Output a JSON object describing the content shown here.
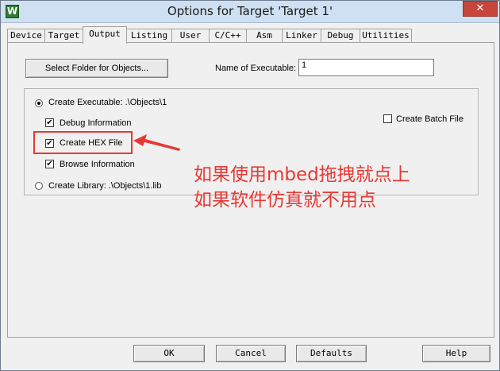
{
  "window": {
    "title": "Options for Target 'Target 1'",
    "close_label": "✕",
    "app_icon_label": "W"
  },
  "tabs": [
    {
      "label": "Device"
    },
    {
      "label": "Target"
    },
    {
      "label": "Output",
      "active": true
    },
    {
      "label": "Listing"
    },
    {
      "label": "User"
    },
    {
      "label": "C/C++"
    },
    {
      "label": "Asm"
    },
    {
      "label": "Linker"
    },
    {
      "label": "Debug"
    },
    {
      "label": "Utilities"
    }
  ],
  "output": {
    "select_folder_label": "Select Folder for Objects...",
    "name_label": "Name of Executable:",
    "name_value": "1",
    "create_executable_label": "Create Executable:  .\\Objects\\1",
    "create_executable_selected": true,
    "debug_info_label": "Debug Information",
    "debug_info_checked": true,
    "create_hex_label": "Create HEX File",
    "create_hex_checked": true,
    "browse_info_label": "Browse Information",
    "browse_info_checked": true,
    "create_library_label": "Create Library:  .\\Objects\\1.lib",
    "create_library_selected": false,
    "create_batch_label": "Create Batch File",
    "create_batch_checked": false
  },
  "annotation": {
    "line1": "如果使用mbed拖拽就点上",
    "line2": "如果软件仿真就不用点",
    "color": "#e53935"
  },
  "footer": {
    "ok_label": "OK",
    "cancel_label": "Cancel",
    "defaults_label": "Defaults",
    "help_label": "Help"
  },
  "check_mark": "✔"
}
